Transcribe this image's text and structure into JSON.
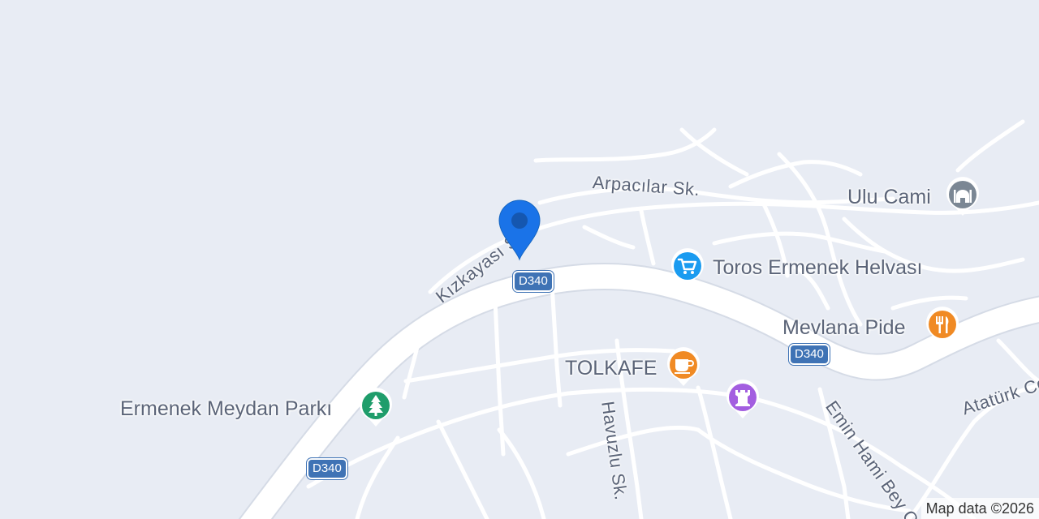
{
  "map": {
    "attribution": "Map data ©2026",
    "colors": {
      "land": "#e8ecf4",
      "road": "#ffffff",
      "road_outline": "#d5dbe6",
      "label": "#5b6478",
      "shield": "#3f73b5",
      "marker": "#1a73e8"
    }
  },
  "streets": {
    "arpacilar": "Arpacılar Sk.",
    "kizkayasi": "Kızkayası S",
    "havuzlu": "Havuzlu Sk.",
    "emin_hami_bey": "Emin Hami Bey Cd.",
    "ataturk": "Atatürk Cd"
  },
  "shields": {
    "d340_a": "D340",
    "d340_b": "D340",
    "d340_c": "D340"
  },
  "pois": {
    "ulu_cami": {
      "label": "Ulu Cami",
      "icon": "mosque-icon",
      "color": "#7b8794"
    },
    "toros": {
      "label": "Toros Ermenek Helvası",
      "icon": "shopping-cart-icon",
      "color": "#1a9bf0"
    },
    "mevlana": {
      "label": "Mevlana Pide",
      "icon": "restaurant-icon",
      "color": "#f08a24"
    },
    "tolkafe": {
      "label": "TOLKAFE",
      "icon": "cafe-icon",
      "color": "#f08a24"
    },
    "park": {
      "label": "Ermenek Meydan Parkı",
      "icon": "tree-icon",
      "color": "#1f9d6b"
    },
    "castle": {
      "label": "",
      "icon": "castle-icon",
      "color": "#a35ee0"
    }
  },
  "marker": {
    "icon": "location-pin-icon"
  }
}
